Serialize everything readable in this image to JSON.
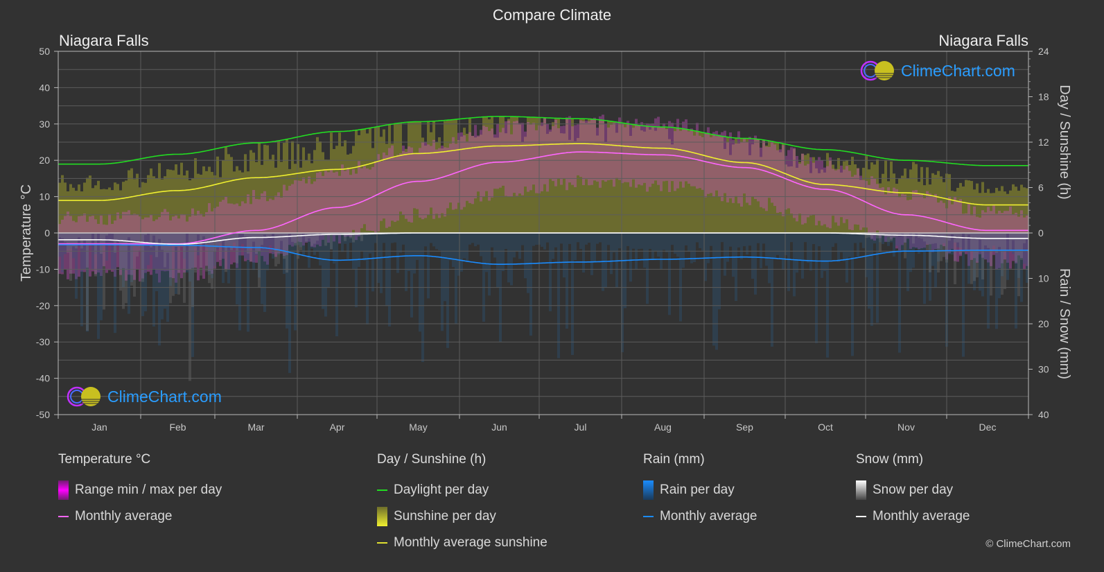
{
  "title": "Compare Climate",
  "location_left": "Niagara Falls",
  "location_right": "Niagara Falls",
  "watermark": "ClimeChart.com",
  "copyright": "© ClimeChart.com",
  "colors": {
    "background": "#323232",
    "temp_avg": "#ff66ff",
    "temp_range": "#e020e0",
    "daylight": "#22dd22",
    "sunshine_bar": "#a8a830",
    "sunshine_avg": "#f0f030",
    "rain_bar": "#1e6ea8",
    "rain_avg": "#1a8cff",
    "snow_bar": "#8a8a8a",
    "snow_avg": "#ffffff",
    "watermark": "#2a9dff"
  },
  "legend": {
    "temperature": {
      "title": "Temperature °C",
      "range": "Range min / max per day",
      "avg": "Monthly average"
    },
    "sunshine": {
      "title": "Day / Sunshine (h)",
      "daylight": "Daylight per day",
      "sunshine": "Sunshine per day",
      "avg": "Monthly average sunshine"
    },
    "rain": {
      "title": "Rain (mm)",
      "per_day": "Rain per day",
      "avg": "Monthly average"
    },
    "snow": {
      "title": "Snow (mm)",
      "per_day": "Snow per day",
      "avg": "Monthly average"
    }
  },
  "chart_data": {
    "type": "line",
    "title": "Compare Climate",
    "categories": [
      "Jan",
      "Feb",
      "Mar",
      "Apr",
      "May",
      "Jun",
      "Jul",
      "Aug",
      "Sep",
      "Oct",
      "Nov",
      "Dec"
    ],
    "axes": {
      "left": {
        "label": "Temperature °C",
        "range": [
          -50,
          50
        ],
        "ticks": [
          50,
          40,
          30,
          20,
          10,
          0,
          -10,
          -20,
          -30,
          -40,
          -50
        ]
      },
      "right_top": {
        "label": "Day / Sunshine (h)",
        "range": [
          0,
          24
        ],
        "ticks": [
          24,
          18,
          12,
          6,
          0
        ]
      },
      "right_bottom": {
        "label": "Rain / Snow (mm)",
        "range": [
          0,
          40
        ],
        "ticks": [
          0,
          10,
          20,
          30,
          40
        ]
      }
    },
    "grid": true,
    "legend_position": "bottom",
    "series": [
      {
        "name": "Temperature monthly average (°C)",
        "axis": "left",
        "values": [
          -3.0,
          -3.0,
          0.7,
          7.0,
          14.2,
          19.5,
          22.3,
          21.5,
          18.0,
          12.0,
          5.0,
          0.7
        ]
      },
      {
        "name": "Daylight per day (h)",
        "axis": "right_top",
        "values": [
          9.1,
          10.4,
          11.9,
          13.4,
          14.7,
          15.4,
          15.1,
          14.0,
          12.5,
          11.0,
          9.6,
          8.9
        ]
      },
      {
        "name": "Monthly average sunshine (h)",
        "axis": "right_top",
        "values": [
          4.3,
          5.6,
          7.3,
          8.4,
          10.5,
          11.5,
          11.8,
          11.2,
          9.3,
          6.4,
          5.3,
          3.7
        ]
      },
      {
        "name": "Rain monthly average (mm)",
        "axis": "right_bottom",
        "values": [
          2.6,
          2.7,
          3.2,
          6.0,
          5.0,
          6.9,
          6.4,
          5.8,
          5.3,
          6.2,
          4.0,
          3.8
        ]
      },
      {
        "name": "Snow monthly average (mm)",
        "axis": "right_bottom",
        "values": [
          1.5,
          2.5,
          1.0,
          0.3,
          0.0,
          0.0,
          0.0,
          0.0,
          0.0,
          0.0,
          0.5,
          1.2
        ]
      }
    ],
    "temp_range_band": {
      "min": [
        -9,
        -10,
        -5,
        1,
        7,
        13,
        16,
        15,
        11,
        5,
        -1,
        -6
      ],
      "max": [
        2,
        3,
        8,
        15,
        22,
        27,
        29,
        28,
        24,
        17,
        9,
        4
      ]
    }
  }
}
